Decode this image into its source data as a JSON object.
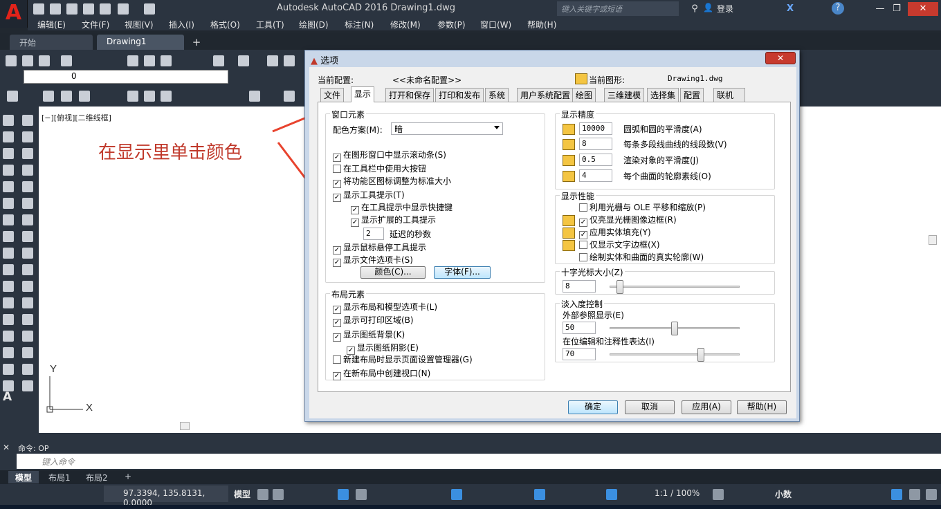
{
  "titlebar": {
    "title": "Autodesk AutoCAD 2016    Drawing1.dwg",
    "search_placeholder": "键入关键字或短语",
    "login": "登录"
  },
  "menu": [
    "编辑(E)",
    "文件(F)",
    "视图(V)",
    "插入(I)",
    "格式(O)",
    "工具(T)",
    "绘图(D)",
    "标注(N)",
    "修改(M)",
    "参数(P)",
    "窗口(W)",
    "帮助(H)"
  ],
  "doctabs": [
    "开始",
    "Drawing1"
  ],
  "layer_value": "0",
  "viewport_label": "[−][俯视][二维线框]",
  "annotation": "在显示里单击颜色",
  "dialog": {
    "title": "选项",
    "current_profile_label": "当前配置:",
    "current_profile_value": "<<未命名配置>>",
    "current_drawing_label": "当前图形:",
    "current_drawing_value": "Drawing1.dwg",
    "tabs": [
      "文件",
      "显示",
      "打开和保存",
      "打印和发布",
      "系统",
      "用户系统配置",
      "绘图",
      "三维建模",
      "选择集",
      "配置",
      "联机"
    ],
    "window_elements": {
      "title": "窗口元素",
      "scheme_label": "配色方案(M):",
      "scheme_value": "暗",
      "checks": [
        "在图形窗口中显示滚动条(S)",
        "在工具栏中使用大按钮",
        "将功能区图标调整为标准大小",
        "显示工具提示(T)",
        "在工具提示中显示快捷键",
        "显示扩展的工具提示"
      ],
      "checked": [
        true,
        false,
        true,
        true,
        true,
        true
      ],
      "delay_value": "2",
      "delay_label": "延迟的秒数",
      "checks2": [
        "显示鼠标悬停工具提示",
        "显示文件选项卡(S)"
      ],
      "color_button": "颜色(C)...",
      "font_button": "字体(F)..."
    },
    "layout_elements": {
      "title": "布局元素",
      "checks": [
        "显示布局和模型选项卡(L)",
        "显示可打印区域(B)",
        "显示图纸背景(K)",
        "显示图纸阴影(E)",
        "新建布局时显示页面设置管理器(G)",
        "在新布局中创建视口(N)"
      ],
      "checked": [
        true,
        true,
        true,
        true,
        false,
        true
      ]
    },
    "display_resolution": {
      "title": "显示精度",
      "rows": [
        {
          "value": "10000",
          "label": "圆弧和圆的平滑度(A)"
        },
        {
          "value": "8",
          "label": "每条多段线曲线的线段数(V)"
        },
        {
          "value": "0.5",
          "label": "渲染对象的平滑度(J)"
        },
        {
          "value": "4",
          "label": "每个曲面的轮廓素线(O)"
        }
      ]
    },
    "display_performance": {
      "title": "显示性能",
      "checks": [
        "利用光栅与 OLE 平移和缩放(P)",
        "仅亮显光栅图像边框(R)",
        "应用实体填充(Y)",
        "仅显示文字边框(X)",
        "绘制实体和曲面的真实轮廓(W)"
      ],
      "checked": [
        false,
        true,
        true,
        false,
        false
      ]
    },
    "crosshair": {
      "title": "十字光标大小(Z)",
      "value": "8",
      "fraction": 0.08
    },
    "fade": {
      "title": "淡入度控制",
      "xref_label": "外部参照显示(E)",
      "xref_value": "50",
      "xref_fraction": 0.5,
      "inplace_label": "在位编辑和注释性表达(I)",
      "inplace_value": "70",
      "inplace_fraction": 0.7
    },
    "buttons": {
      "ok": "确定",
      "cancel": "取消",
      "apply": "应用(A)",
      "help": "帮助(H)"
    }
  },
  "command": {
    "history": "命令: OP",
    "placeholder": "键入命令"
  },
  "layout_tabs": [
    "模型",
    "布局1",
    "布局2"
  ],
  "status": {
    "coords": "97.3394, 135.8131, 0.0000",
    "model": "模型",
    "scale": "1:1 / 100%",
    "units": "小数"
  }
}
